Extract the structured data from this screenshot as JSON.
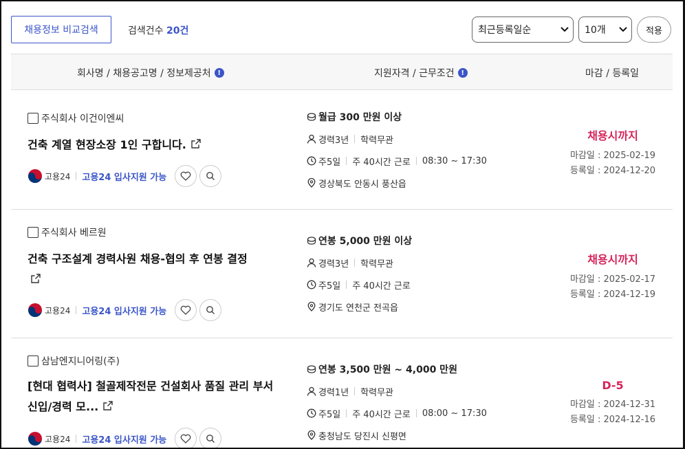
{
  "toolbar": {
    "compare_label": "채용정보 비교검색",
    "count_prefix": "검색건수",
    "count_value": "20건",
    "sort_value": "최근등록일순",
    "page_size_value": "10개",
    "apply_label": "적용"
  },
  "table_header": {
    "col1": "회사명 / 채용공고명 / 정보제공처",
    "col2": "지원자격 / 근무조건",
    "col3": "마감 / 등록일",
    "info_glyph": "!"
  },
  "jobs": [
    {
      "company": "주식회사 이건이엔씨",
      "title": "건축 계열 현장소장 1인 구합니다.",
      "source_name": "고용24",
      "source_link": "고용24 입사지원 가능",
      "salary": "월급 300 만원 이상",
      "career": "경력3년",
      "education": "학력무관",
      "workdays": "주5일",
      "hours": "주 40시간 근로",
      "time": "08:30 ~ 17:30",
      "location": "경상북도 안동시 풍산읍",
      "deadline_label": "채용시까지",
      "deadline_date": "마감일 : 2025-02-19",
      "reg_date": "등록일 : 2024-12-20"
    },
    {
      "company": "주식회사 베르원",
      "title": "건축 구조설계 경력사원 채용-협의 후 연봉 결정",
      "source_name": "고용24",
      "source_link": "고용24 입사지원 가능",
      "salary": "연봉 5,000 만원 이상",
      "career": "경력3년",
      "education": "학력무관",
      "workdays": "주5일",
      "hours": "주 40시간 근로",
      "time": "",
      "location": "경기도 연천군 전곡읍",
      "deadline_label": "채용시까지",
      "deadline_date": "마감일 : 2025-02-17",
      "reg_date": "등록일 : 2024-12-19"
    },
    {
      "company": "삼남엔지니어링(주)",
      "title": "[현대 협력사] 철골제작전문 건설회사 품질 관리 부서 신입/경력 모...",
      "source_name": "고용24",
      "source_link": "고용24 입사지원 가능",
      "salary": "연봉 3,500 만원 ~ 4,000 만원",
      "career": "경력1년",
      "education": "학력무관",
      "workdays": "주5일",
      "hours": "주 40시간 근로",
      "time": "08:00 ~ 17:30",
      "location": "충청남도 당진시 신평면",
      "deadline_label": "D-5",
      "deadline_date": "마감일 : 2024-12-31",
      "reg_date": "등록일 : 2024-12-16"
    }
  ]
}
